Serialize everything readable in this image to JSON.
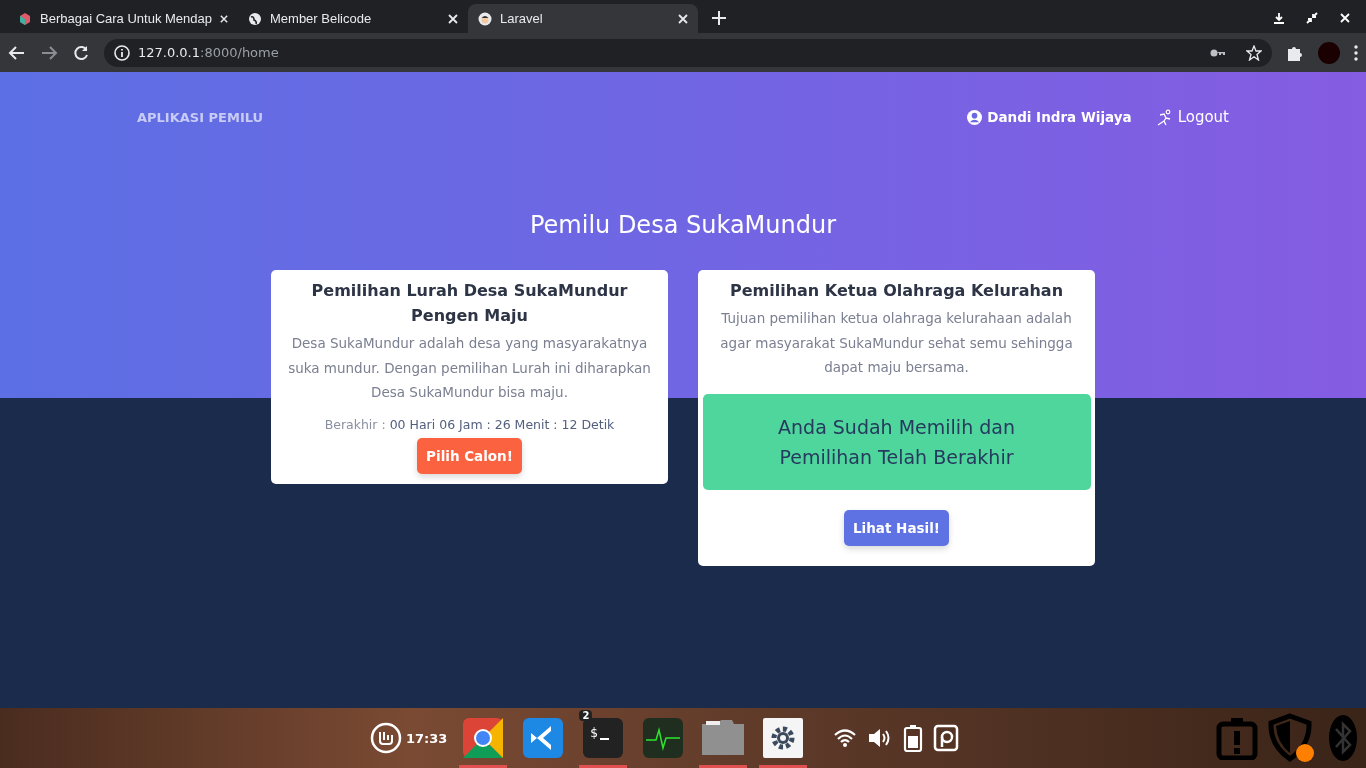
{
  "browser": {
    "tabs": [
      {
        "title": "Berbagai Cara Untuk Mendap",
        "selected": false
      },
      {
        "title": "Member Belicode",
        "selected": false
      },
      {
        "title": "Laravel",
        "selected": true
      }
    ],
    "address": {
      "host": "127.0.0.1",
      "path": ":8000/home"
    }
  },
  "navbar": {
    "brand": "APLIKASI PEMILU",
    "user": "Dandi Indra Wijaya",
    "logout": "Logout"
  },
  "heading": "Pemilu Desa SukaMundur",
  "cards": [
    {
      "kind": "open",
      "title": "Pemilihan Lurah Desa SukaMundur Pengen Maju",
      "description": "Desa SukaMundur adalah desa yang masyarakatnya suka mundur. Dengan pemilihan Lurah ini diharapkan Desa SukaMundur bisa maju.",
      "countdown_label": "Berakhir :",
      "countdown_value": "00 Hari 06 Jam : 26 Menit : 12 Detik",
      "button": "Pilih Calon!"
    },
    {
      "kind": "closed",
      "title": "Pemilihan Ketua Olahraga Kelurahan",
      "description": "Tujuan pemilihan ketua olahraga kelurahaan adalah agar masyarakat SukaMundur sehat semu sehingga dapat maju bersama.",
      "notice": "Anda Sudah Memilih dan Pemilihan Telah Berakhir",
      "button": "Lihat Hasil!"
    }
  ],
  "taskbar": {
    "clock": "17:33",
    "apps": [
      {
        "kind": "chrome",
        "running": true
      },
      {
        "kind": "vscode",
        "running": false
      },
      {
        "kind": "terminal",
        "running": true,
        "badge": "2",
        "glyph": "$"
      },
      {
        "kind": "monitor",
        "running": false
      },
      {
        "kind": "files",
        "running": true
      },
      {
        "kind": "settings",
        "running": true
      }
    ]
  }
}
